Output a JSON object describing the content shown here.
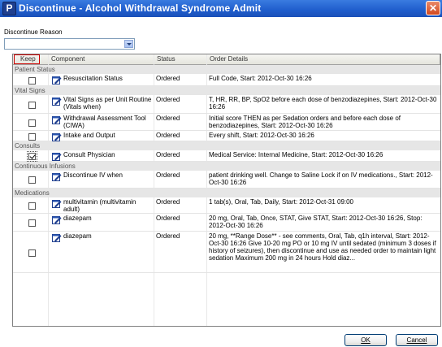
{
  "window": {
    "title": "Discontinue - Alcohol Withdrawal Syndrome Admit",
    "app_icon": "P",
    "close_glyph": "✕"
  },
  "reason": {
    "label": "Discontinue Reason",
    "value": ""
  },
  "columns": {
    "keep": "Keep",
    "component": "Component",
    "status": "Status",
    "details": "Order Details"
  },
  "sections": [
    {
      "label": "Patient Status",
      "rows": [
        {
          "checked": false,
          "component": "Resuscitation Status",
          "status": "Ordered",
          "details": "Full Code, Start: 2012-Oct-30 16:26"
        }
      ]
    },
    {
      "label": "Vital Signs",
      "rows": [
        {
          "checked": false,
          "component": "Vital Signs as per Unit Routine (Vitals when)",
          "status": "Ordered",
          "details": "T, HR, RR, BP, SpO2 before each dose of benzodiazepines, Start: 2012-Oct-30 16:26"
        },
        {
          "checked": false,
          "component": "Withdrawal Assessment Tool (CIWA)",
          "status": "Ordered",
          "details": "Initial score THEN as per Sedation orders and before each dose of benzodiazepines, Start: 2012-Oct-30 16:26"
        },
        {
          "checked": false,
          "component": "Intake and Output",
          "status": "Ordered",
          "details": "Every shift, Start: 2012-Oct-30 16:26"
        }
      ]
    },
    {
      "label": "Consults",
      "rows": [
        {
          "checked": true,
          "component": "Consult Physician",
          "status": "Ordered",
          "details": "Medical Service: Internal Medicine, Start: 2012-Oct-30 16:26"
        }
      ]
    },
    {
      "label": "Continuous Infusions",
      "rows": [
        {
          "checked": false,
          "component": "Discontinue IV when",
          "status": "Ordered",
          "details": "patient drinking well. Change to Saline Lock if on IV medications., Start: 2012-Oct-30 16:26"
        }
      ]
    },
    {
      "label": "Medications",
      "rows": [
        {
          "checked": false,
          "component": "multivitamin (multivitamin adult)",
          "status": "Ordered",
          "details": "1 tab(s), Oral, Tab, Daily, Start: 2012-Oct-31 09:00"
        },
        {
          "checked": false,
          "component": "diazepam",
          "status": "Ordered",
          "details": "20 mg, Oral, Tab, Once, STAT, Give STAT, Start: 2012-Oct-30 16:26, Stop: 2012-Oct-30 16:26"
        },
        {
          "checked": false,
          "component": "diazepam",
          "status": "Ordered",
          "details": "20 mg, **Range Dose** - see comments, Oral, Tab, q1h interval, Start: 2012-Oct-30 16:26 Give 10-20 mg PO or 10 mg IV until sedated (minimum 3 doses if history of seizures), then discontinue and use as needed order to maintain light sedation   Maximum 200 mg in 24 hours   Hold diaz..."
        }
      ]
    }
  ],
  "buttons": {
    "ok": "OK",
    "cancel": "Cancel"
  }
}
